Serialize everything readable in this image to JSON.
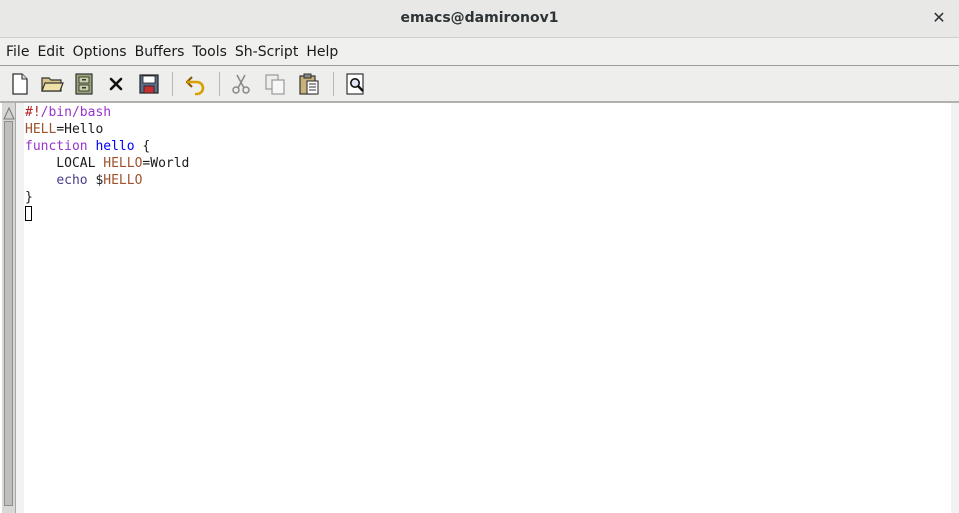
{
  "window": {
    "title": "emacs@damironov1",
    "close_glyph": "✕"
  },
  "menubar": {
    "items": [
      "File",
      "Edit",
      "Options",
      "Buffers",
      "Tools",
      "Sh-Script",
      "Help"
    ]
  },
  "toolbar": {
    "buttons": [
      "new-file-icon",
      "open-folder-icon",
      "dired-icon",
      "close-buffer-icon",
      "save-icon",
      "undo-icon",
      "cut-icon",
      "copy-icon",
      "paste-icon",
      "search-icon"
    ]
  },
  "editor": {
    "lines": [
      {
        "tokens": [
          {
            "t": "#!",
            "c": "comment"
          },
          {
            "t": "/bin/bash",
            "c": "pp"
          }
        ]
      },
      {
        "tokens": [
          {
            "t": "HELL",
            "c": "var"
          },
          {
            "t": "=Hello",
            "c": "plain"
          }
        ]
      },
      {
        "tokens": [
          {
            "t": "function",
            "c": "kw"
          },
          {
            "t": " ",
            "c": "plain"
          },
          {
            "t": "hello",
            "c": "fn"
          },
          {
            "t": " {",
            "c": "plain"
          }
        ]
      },
      {
        "tokens": [
          {
            "t": "    LOCAL ",
            "c": "plain"
          },
          {
            "t": "HELLO",
            "c": "var"
          },
          {
            "t": "=World",
            "c": "plain"
          }
        ]
      },
      {
        "tokens": [
          {
            "t": "    ",
            "c": "plain"
          },
          {
            "t": "echo",
            "c": "builtin"
          },
          {
            "t": " $",
            "c": "plain"
          },
          {
            "t": "HELLO",
            "c": "var"
          }
        ]
      },
      {
        "tokens": [
          {
            "t": "}",
            "c": "plain"
          }
        ]
      }
    ]
  },
  "colors": {
    "comment": "#b22222",
    "preprocessor": "#9933cc",
    "variable": "#a0522d",
    "keyword": "#9933cc",
    "function_name": "#0000ff",
    "builtin": "#483d8b"
  }
}
